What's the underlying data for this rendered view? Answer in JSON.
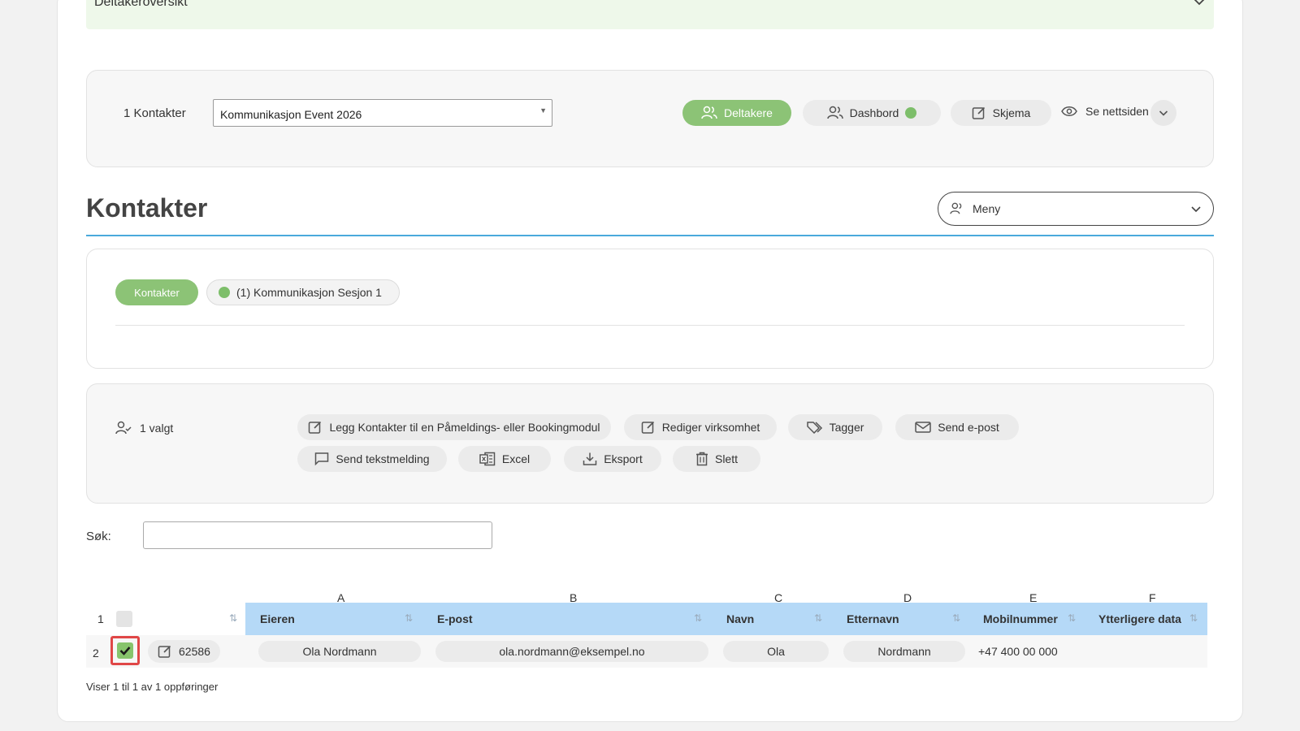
{
  "accordion": {
    "title": "Deltakeroversikt"
  },
  "event_bar": {
    "count_label": "1 Kontakter",
    "event_select_value": "Kommunikasjon Event 2026",
    "nav": {
      "deltakere": "Deltakere",
      "dashbord": "Dashbord",
      "skjema": "Skjema",
      "se_nettsiden": "Se nettsiden"
    }
  },
  "heading": {
    "title": "Kontakter",
    "menu_label": "Meny"
  },
  "tabs": {
    "kontakter": "Kontakter",
    "session": "(1) Kommunikasjon Sesjon 1"
  },
  "actions": {
    "selected_count": "1 valgt",
    "buttons": {
      "add_to_module": "Legg Kontakter til en Påmeldings- eller Bookingmodul",
      "edit_company": "Rediger virksomhet",
      "tags": "Tagger",
      "send_email": "Send e-post",
      "send_sms": "Send tekstmelding",
      "excel": "Excel",
      "export": "Eksport",
      "delete": "Slett"
    }
  },
  "search": {
    "label": "Søk:",
    "value": ""
  },
  "table": {
    "column_letters": [
      "A",
      "B",
      "C",
      "D",
      "E",
      "F"
    ],
    "header_row_number": "1",
    "headers": {
      "owner": "Eieren",
      "email": "E-post",
      "first_name": "Navn",
      "last_name": "Etternavn",
      "mobile": "Mobilnummer",
      "extra": "Ytterligere data"
    },
    "rows": [
      {
        "row_number": "2",
        "checked": true,
        "id": "62586",
        "owner": "Ola Nordmann",
        "email": "ola.nordmann@eksempel.no",
        "first_name": "Ola",
        "last_name": "Nordmann",
        "mobile": "+47 400 00 000",
        "extra": ""
      }
    ],
    "footer": "Viser 1 til 1 av 1 oppføringer"
  },
  "colors": {
    "accent_green": "#8cc376",
    "header_blue": "#b5d9f7",
    "rule_blue": "#4aa9dc",
    "highlight_red": "#e04747"
  }
}
